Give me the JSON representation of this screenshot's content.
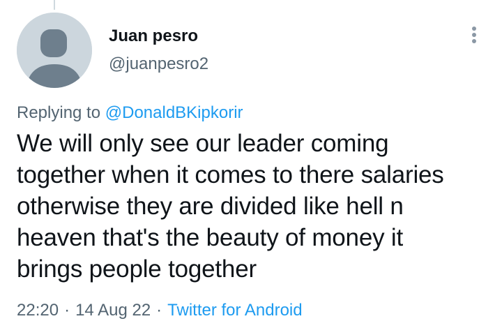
{
  "tweet": {
    "author": {
      "display_name": "Juan pesro",
      "handle": "@juanpesro2"
    },
    "replying_to": {
      "prefix": "Replying to",
      "mention": "@DonaldBKipkorir"
    },
    "text": "We will only see our leader coming\ntogether when it comes to there salaries\notherwise they are divided like hell n\nheaven that's the beauty of money it\nbrings people together",
    "time": "22:20",
    "separator": "·",
    "date": "14 Aug 22",
    "source": "Twitter for Android"
  },
  "icons": {
    "avatar": "default-avatar-icon",
    "more": "more-vertical-icon"
  },
  "colors": {
    "link": "#1d9bf0",
    "secondary_text": "#536471",
    "primary_text": "#0f1419",
    "avatar_bg": "#ccd6dd",
    "avatar_fg": "#6e7f8d"
  }
}
